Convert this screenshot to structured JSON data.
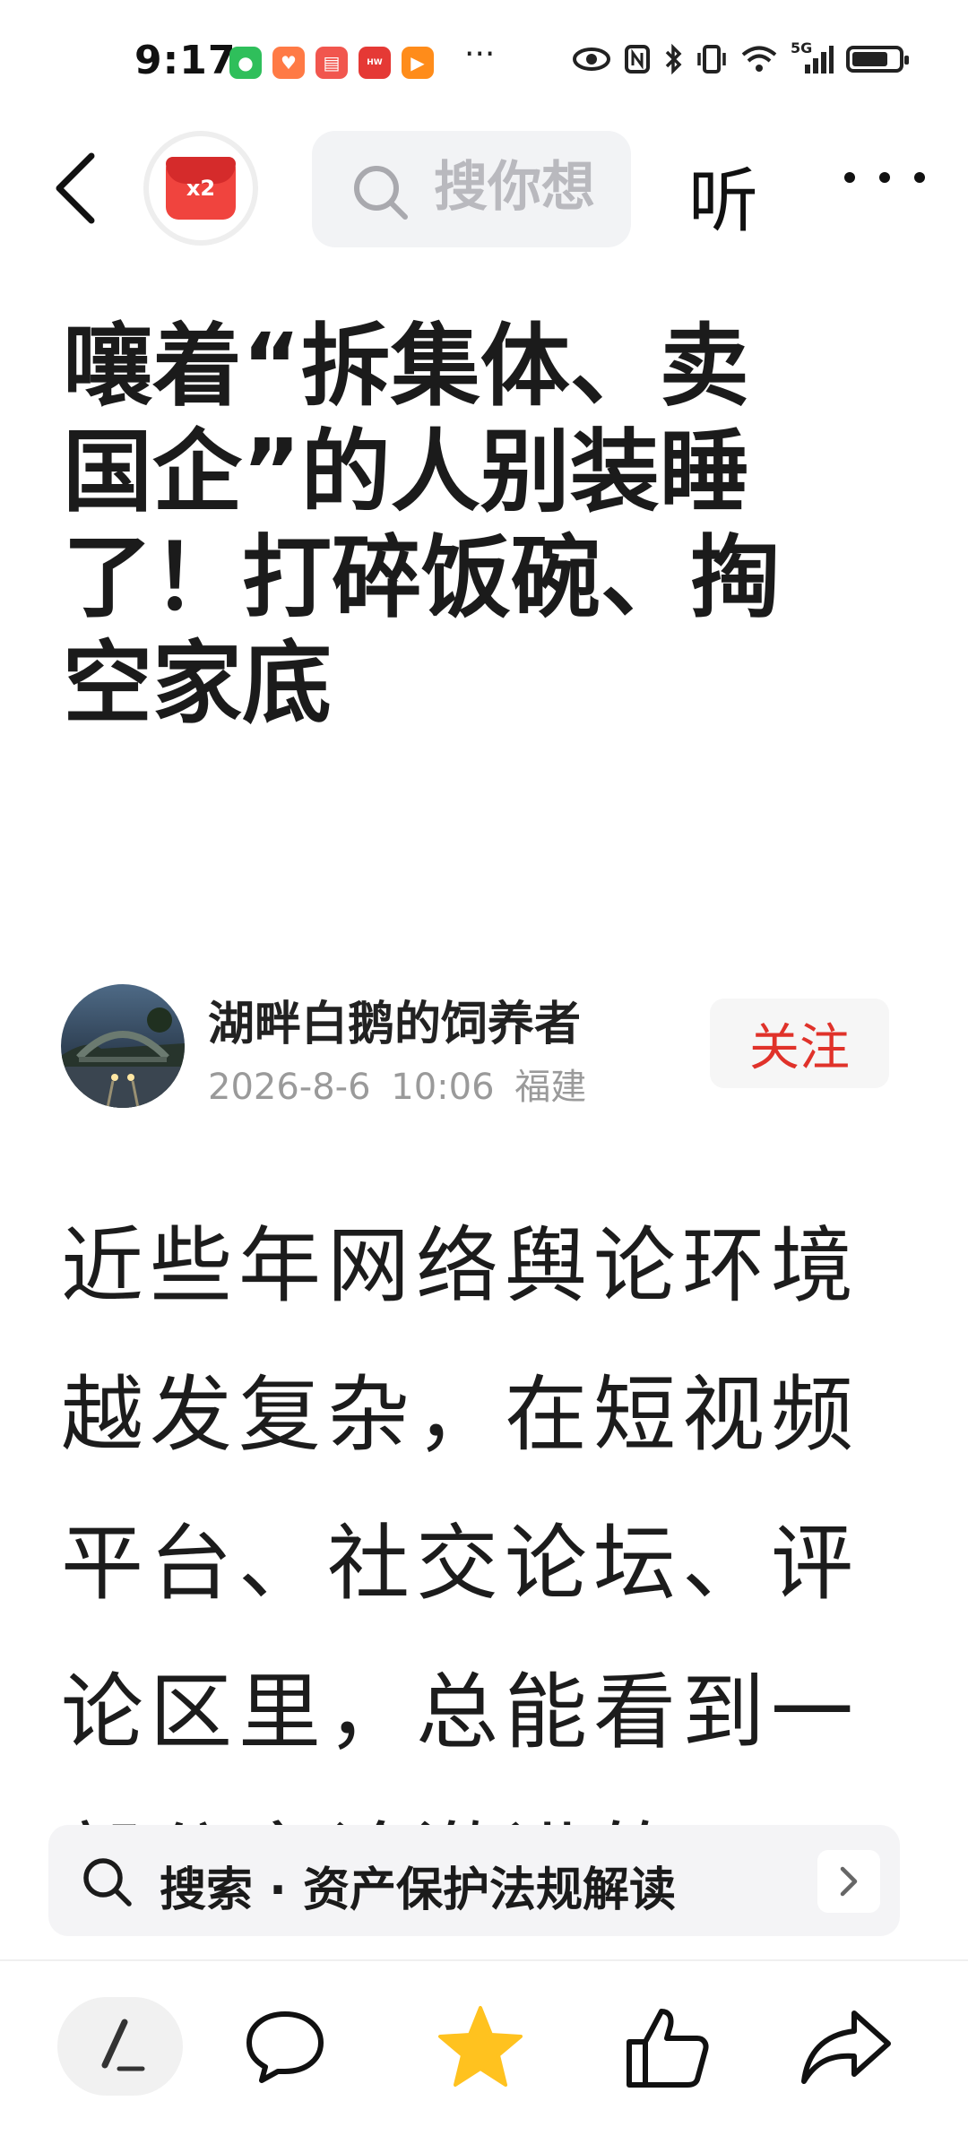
{
  "status_bar": {
    "time": "9:17",
    "notification_icons": [
      "wechat-icon",
      "health-icon",
      "reader-icon",
      "huawei-icon",
      "video-icon"
    ],
    "overflow": "···",
    "network": "5G",
    "battery_level": 0.78
  },
  "top_nav": {
    "back_icon": "chevron-left-icon",
    "red_packet_badge": "x2",
    "search_placeholder": "搜你想",
    "listen_label": "听",
    "more_icon": "more-horizontal-icon"
  },
  "article": {
    "title_lines": [
      "嚷着“拆集体、卖",
      "国企”的人别装睡",
      "了！打碎饭碗、掏",
      "空家底"
    ],
    "author": {
      "name": "湖畔白鹅的饲养者",
      "date": "2026-8-6",
      "time": "10:06",
      "location": "福建",
      "follow_label": "关注"
    },
    "body_lines": [
      "近些年网络舆论环境",
      "越发复杂，在短视频",
      "平台、社交论坛、评",
      "论区里，总能看到一",
      "部分言论激进的网"
    ]
  },
  "search_suggestion": {
    "text": "搜索 · 资产保护法规解读",
    "arrow_icon": "chevron-right-icon"
  },
  "toolbar": {
    "items": [
      "comment-input-icon",
      "comment-icon",
      "favorite-star-icon",
      "like-thumb-icon",
      "share-icon"
    ]
  },
  "colors": {
    "accent_red": "#e0322a",
    "star_yellow": "#ffc21f",
    "red_packet": "#f0443e"
  }
}
